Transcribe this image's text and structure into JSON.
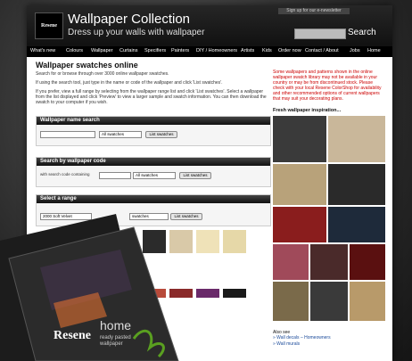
{
  "header": {
    "logo_text": "Resene",
    "title": "Wallpaper Collection",
    "subtitle": "Dress up your walls with wallpaper",
    "newsletter": "Sign up for our e-newsletter",
    "search_label": "Search"
  },
  "nav": [
    "What's new",
    "Colours",
    "Wallpaper",
    "Curtains",
    "Specifiers",
    "Painters",
    "DIY / Homeowners",
    "Artists",
    "Kids",
    "Order now",
    "Contact / About",
    "Jobs",
    "Home"
  ],
  "main": {
    "title": "Wallpaper swatches online",
    "intro1": "Search for or browse through over 3000 online wallpaper swatches.",
    "intro2": "If using the search tool, just type in the name or code of the wallpaper and click 'List swatches'.",
    "intro3": "If you prefer, view a full range by selecting from the wallpaper range list and click 'List swatches'. Select a wallpaper from the list displayed and click 'Preview' to view a larger sample and swatch information. You can then download the swatch to your computer if you wish.",
    "panel_name": {
      "title": "Wallpaper name search",
      "select": "All swatches",
      "button": "List swatches"
    },
    "panel_code": {
      "title": "Search by wallpaper code",
      "label": "with search code containing",
      "select": "All swatches",
      "button": "List swatches"
    },
    "panel_range": {
      "title": "Select a range",
      "select1": "2000 Soft Velvet",
      "select2": "swatches",
      "button": "List swatches"
    }
  },
  "swatch_colors": [
    "#2b2b2b",
    "#d9c9a8",
    "#efe2b8",
    "#e6d8a8",
    "#b84a3a",
    "#8a2a2a",
    "#6a2a6a",
    "#1a1a1a"
  ],
  "sidebar": {
    "note": "Some wallpapers and patterns shown in the online wallpaper swatch library may not be available in your country or may be from discontinued stock. Please check with your local Resene ColorShop for availability and other recommended options of current wallpapers that may suit your decorating plans.",
    "inspiration_title": "Fresh wallpaper inspiration...",
    "also_see": "Also see",
    "links": [
      "» Wall decals – Homeowners",
      "» Wall murals"
    ]
  },
  "brochure": {
    "brand": "Resene",
    "line1": "home",
    "line2": "ready pasted",
    "line3": "wallpaper"
  }
}
